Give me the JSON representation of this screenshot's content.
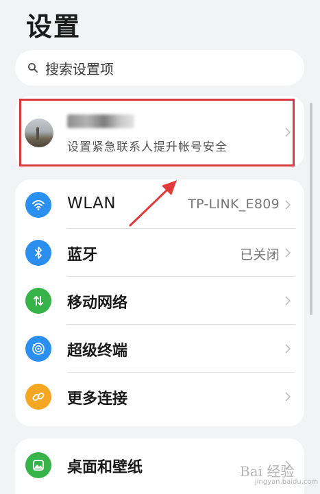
{
  "header": {
    "title": "设置"
  },
  "search": {
    "placeholder": "搜索设置项",
    "icon": "search-icon"
  },
  "account": {
    "name_obscured": true,
    "subtitle": "设置紧急联系人提升帐号安全",
    "highlight_color": "#d8393f"
  },
  "connectivity": {
    "items": [
      {
        "label": "WLAN",
        "value": "TP-LINK_E809",
        "icon": "wifi-icon",
        "color": "#2b8ff0"
      },
      {
        "label": "蓝牙",
        "value": "已关闭",
        "icon": "bluetooth-icon",
        "color": "#2b8ff0"
      },
      {
        "label": "移动网络",
        "value": "",
        "icon": "mobile-data-icon",
        "color": "#37b34a"
      },
      {
        "label": "超级终端",
        "value": "",
        "icon": "super-device-icon",
        "color": "#2b8ff0"
      },
      {
        "label": "更多连接",
        "value": "",
        "icon": "link-icon",
        "color": "#f5a623"
      }
    ]
  },
  "display": {
    "items": [
      {
        "label": "桌面和壁纸",
        "icon": "wallpaper-icon",
        "color": "#37b34a"
      }
    ]
  },
  "annotation": {
    "arrow_color": "#e23a3a"
  },
  "watermark": {
    "text": "Bai 经验",
    "sub": "jingyan.baidu.com"
  }
}
